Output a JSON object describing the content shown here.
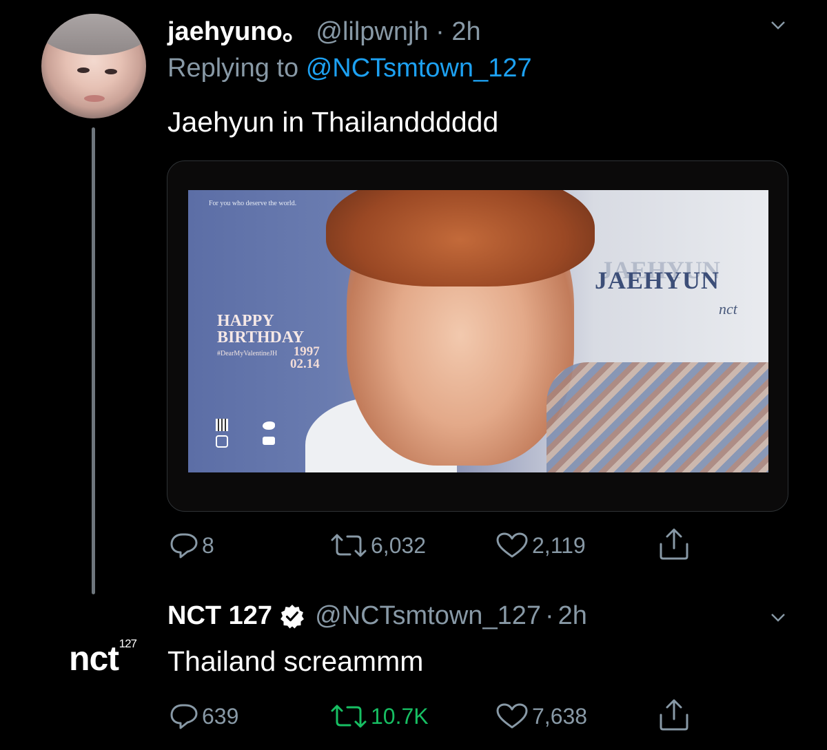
{
  "colors": {
    "background": "#000000",
    "primary_text": "#ffffff",
    "secondary_text": "#8899a6",
    "link": "#1da1f2",
    "retweet_active": "#17bf63"
  },
  "tweet1": {
    "display_name": "jaehyuno。",
    "handle": "@lilpwnjh",
    "separator": "·",
    "time": "2h",
    "replying_prefix": "Replying to",
    "replying_handle": "@NCTsmtown_127",
    "text": "Jaehyun in Thailandddddd",
    "avatar_icon": "profile-photo",
    "media": {
      "top_line": "For you who deserve the world.",
      "happy": "HAPPY",
      "birthday": "BIRTHDAY",
      "hashtag": "#DearMyValentineJH",
      "year": "1997",
      "date": "02.14",
      "name": "JAEHYUN",
      "group": "nct"
    },
    "actions": {
      "replies": "8",
      "retweets": "6,032",
      "likes": "2,119"
    }
  },
  "tweet2": {
    "display_name": "NCT 127",
    "verified_icon": "verified-badge-icon",
    "handle": "@NCTsmtown_127",
    "separator": "·",
    "time": "2h",
    "text": "Thailand screammm",
    "avatar_logo": "nct",
    "avatar_logo_sup": "127",
    "actions": {
      "replies": "639",
      "retweets": "10.7K",
      "likes": "7,638"
    }
  }
}
